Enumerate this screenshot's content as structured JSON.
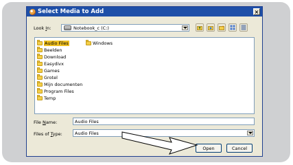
{
  "dialog": {
    "title": "Select Media to Add",
    "close_glyph": "×"
  },
  "look_in": {
    "label_pre": "Look ",
    "label_ul": "I",
    "label_post": "n:",
    "value": "Notebook_c (C:)"
  },
  "toolbar": {
    "icons": [
      "up-folder-icon",
      "desktop-icon",
      "new-folder-icon",
      "list-view-icon",
      "details-view-icon"
    ]
  },
  "files": {
    "items": [
      {
        "label": "Audio Files",
        "selected": true
      },
      {
        "label": "Beelden"
      },
      {
        "label": "Download"
      },
      {
        "label": "Easydivx"
      },
      {
        "label": "Games"
      },
      {
        "label": "Grotel"
      },
      {
        "label": "Mijn documenten"
      },
      {
        "label": "Program Files"
      },
      {
        "label": "Temp"
      },
      {
        "label": "Windows"
      }
    ]
  },
  "file_name": {
    "label_pre": "File ",
    "label_ul": "N",
    "label_post": "ame:",
    "value": "Audio Files"
  },
  "file_type": {
    "label_pre": "Files of ",
    "label_ul": "T",
    "label_post": "ype:",
    "value": "Audio Files"
  },
  "buttons": {
    "open": "Open",
    "cancel": "Cancel"
  },
  "colors": {
    "titlebar": "#1e4fa8",
    "selection": "#f0c020",
    "folder": "#f4cf4a"
  }
}
